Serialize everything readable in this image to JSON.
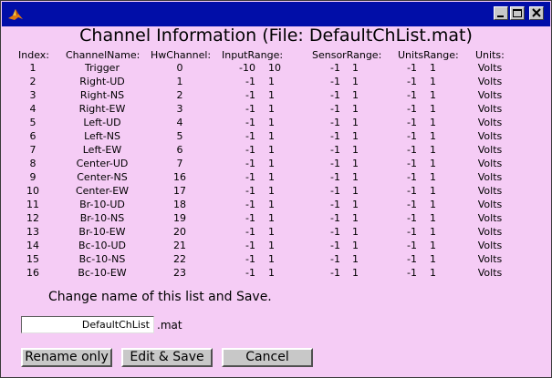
{
  "window": {
    "title": "Channel Information (File: DefaultChList.mat)",
    "controls": [
      "minimize-icon",
      "maximize-icon",
      "close-icon"
    ]
  },
  "table": {
    "headers": {
      "index": "Index:",
      "channel_name": "ChannelName:",
      "hw_channel": "HwChannel:",
      "input_range": "InputRange:",
      "sensor_range": "SensorRange:",
      "units_range": "UnitsRange:",
      "units": "Units:"
    },
    "rows": [
      {
        "index": "1",
        "name": "Trigger",
        "hw": "0",
        "in_min": "-10",
        "in_max": "10",
        "s_min": "-1",
        "s_max": "1",
        "u_min": "-1",
        "u_max": "1",
        "units": "Volts"
      },
      {
        "index": "2",
        "name": "Right-UD",
        "hw": "1",
        "in_min": "-1",
        "in_max": "1",
        "s_min": "-1",
        "s_max": "1",
        "u_min": "-1",
        "u_max": "1",
        "units": "Volts"
      },
      {
        "index": "3",
        "name": "Right-NS",
        "hw": "2",
        "in_min": "-1",
        "in_max": "1",
        "s_min": "-1",
        "s_max": "1",
        "u_min": "-1",
        "u_max": "1",
        "units": "Volts"
      },
      {
        "index": "4",
        "name": "Right-EW",
        "hw": "3",
        "in_min": "-1",
        "in_max": "1",
        "s_min": "-1",
        "s_max": "1",
        "u_min": "-1",
        "u_max": "1",
        "units": "Volts"
      },
      {
        "index": "5",
        "name": "Left-UD",
        "hw": "4",
        "in_min": "-1",
        "in_max": "1",
        "s_min": "-1",
        "s_max": "1",
        "u_min": "-1",
        "u_max": "1",
        "units": "Volts"
      },
      {
        "index": "6",
        "name": "Left-NS",
        "hw": "5",
        "in_min": "-1",
        "in_max": "1",
        "s_min": "-1",
        "s_max": "1",
        "u_min": "-1",
        "u_max": "1",
        "units": "Volts"
      },
      {
        "index": "7",
        "name": "Left-EW",
        "hw": "6",
        "in_min": "-1",
        "in_max": "1",
        "s_min": "-1",
        "s_max": "1",
        "u_min": "-1",
        "u_max": "1",
        "units": "Volts"
      },
      {
        "index": "8",
        "name": "Center-UD",
        "hw": "7",
        "in_min": "-1",
        "in_max": "1",
        "s_min": "-1",
        "s_max": "1",
        "u_min": "-1",
        "u_max": "1",
        "units": "Volts"
      },
      {
        "index": "9",
        "name": "Center-NS",
        "hw": "16",
        "in_min": "-1",
        "in_max": "1",
        "s_min": "-1",
        "s_max": "1",
        "u_min": "-1",
        "u_max": "1",
        "units": "Volts"
      },
      {
        "index": "10",
        "name": "Center-EW",
        "hw": "17",
        "in_min": "-1",
        "in_max": "1",
        "s_min": "-1",
        "s_max": "1",
        "u_min": "-1",
        "u_max": "1",
        "units": "Volts"
      },
      {
        "index": "11",
        "name": "Br-10-UD",
        "hw": "18",
        "in_min": "-1",
        "in_max": "1",
        "s_min": "-1",
        "s_max": "1",
        "u_min": "-1",
        "u_max": "1",
        "units": "Volts"
      },
      {
        "index": "12",
        "name": "Br-10-NS",
        "hw": "19",
        "in_min": "-1",
        "in_max": "1",
        "s_min": "-1",
        "s_max": "1",
        "u_min": "-1",
        "u_max": "1",
        "units": "Volts"
      },
      {
        "index": "13",
        "name": "Br-10-EW",
        "hw": "20",
        "in_min": "-1",
        "in_max": "1",
        "s_min": "-1",
        "s_max": "1",
        "u_min": "-1",
        "u_max": "1",
        "units": "Volts"
      },
      {
        "index": "14",
        "name": "Bc-10-UD",
        "hw": "21",
        "in_min": "-1",
        "in_max": "1",
        "s_min": "-1",
        "s_max": "1",
        "u_min": "-1",
        "u_max": "1",
        "units": "Volts"
      },
      {
        "index": "15",
        "name": "Bc-10-NS",
        "hw": "22",
        "in_min": "-1",
        "in_max": "1",
        "s_min": "-1",
        "s_max": "1",
        "u_min": "-1",
        "u_max": "1",
        "units": "Volts"
      },
      {
        "index": "16",
        "name": "Bc-10-EW",
        "hw": "23",
        "in_min": "-1",
        "in_max": "1",
        "s_min": "-1",
        "s_max": "1",
        "u_min": "-1",
        "u_max": "1",
        "units": "Volts"
      }
    ]
  },
  "rename": {
    "prompt": "Change name of this list and Save.",
    "value": "DefaultChList",
    "suffix": ".mat"
  },
  "buttons": {
    "rename_only": "Rename only",
    "edit_save": "Edit & Save",
    "cancel": "Cancel"
  },
  "colors": {
    "background": "#f5ccf5",
    "titlebar": "#010ea8",
    "button_face": "#c8c8c8"
  }
}
